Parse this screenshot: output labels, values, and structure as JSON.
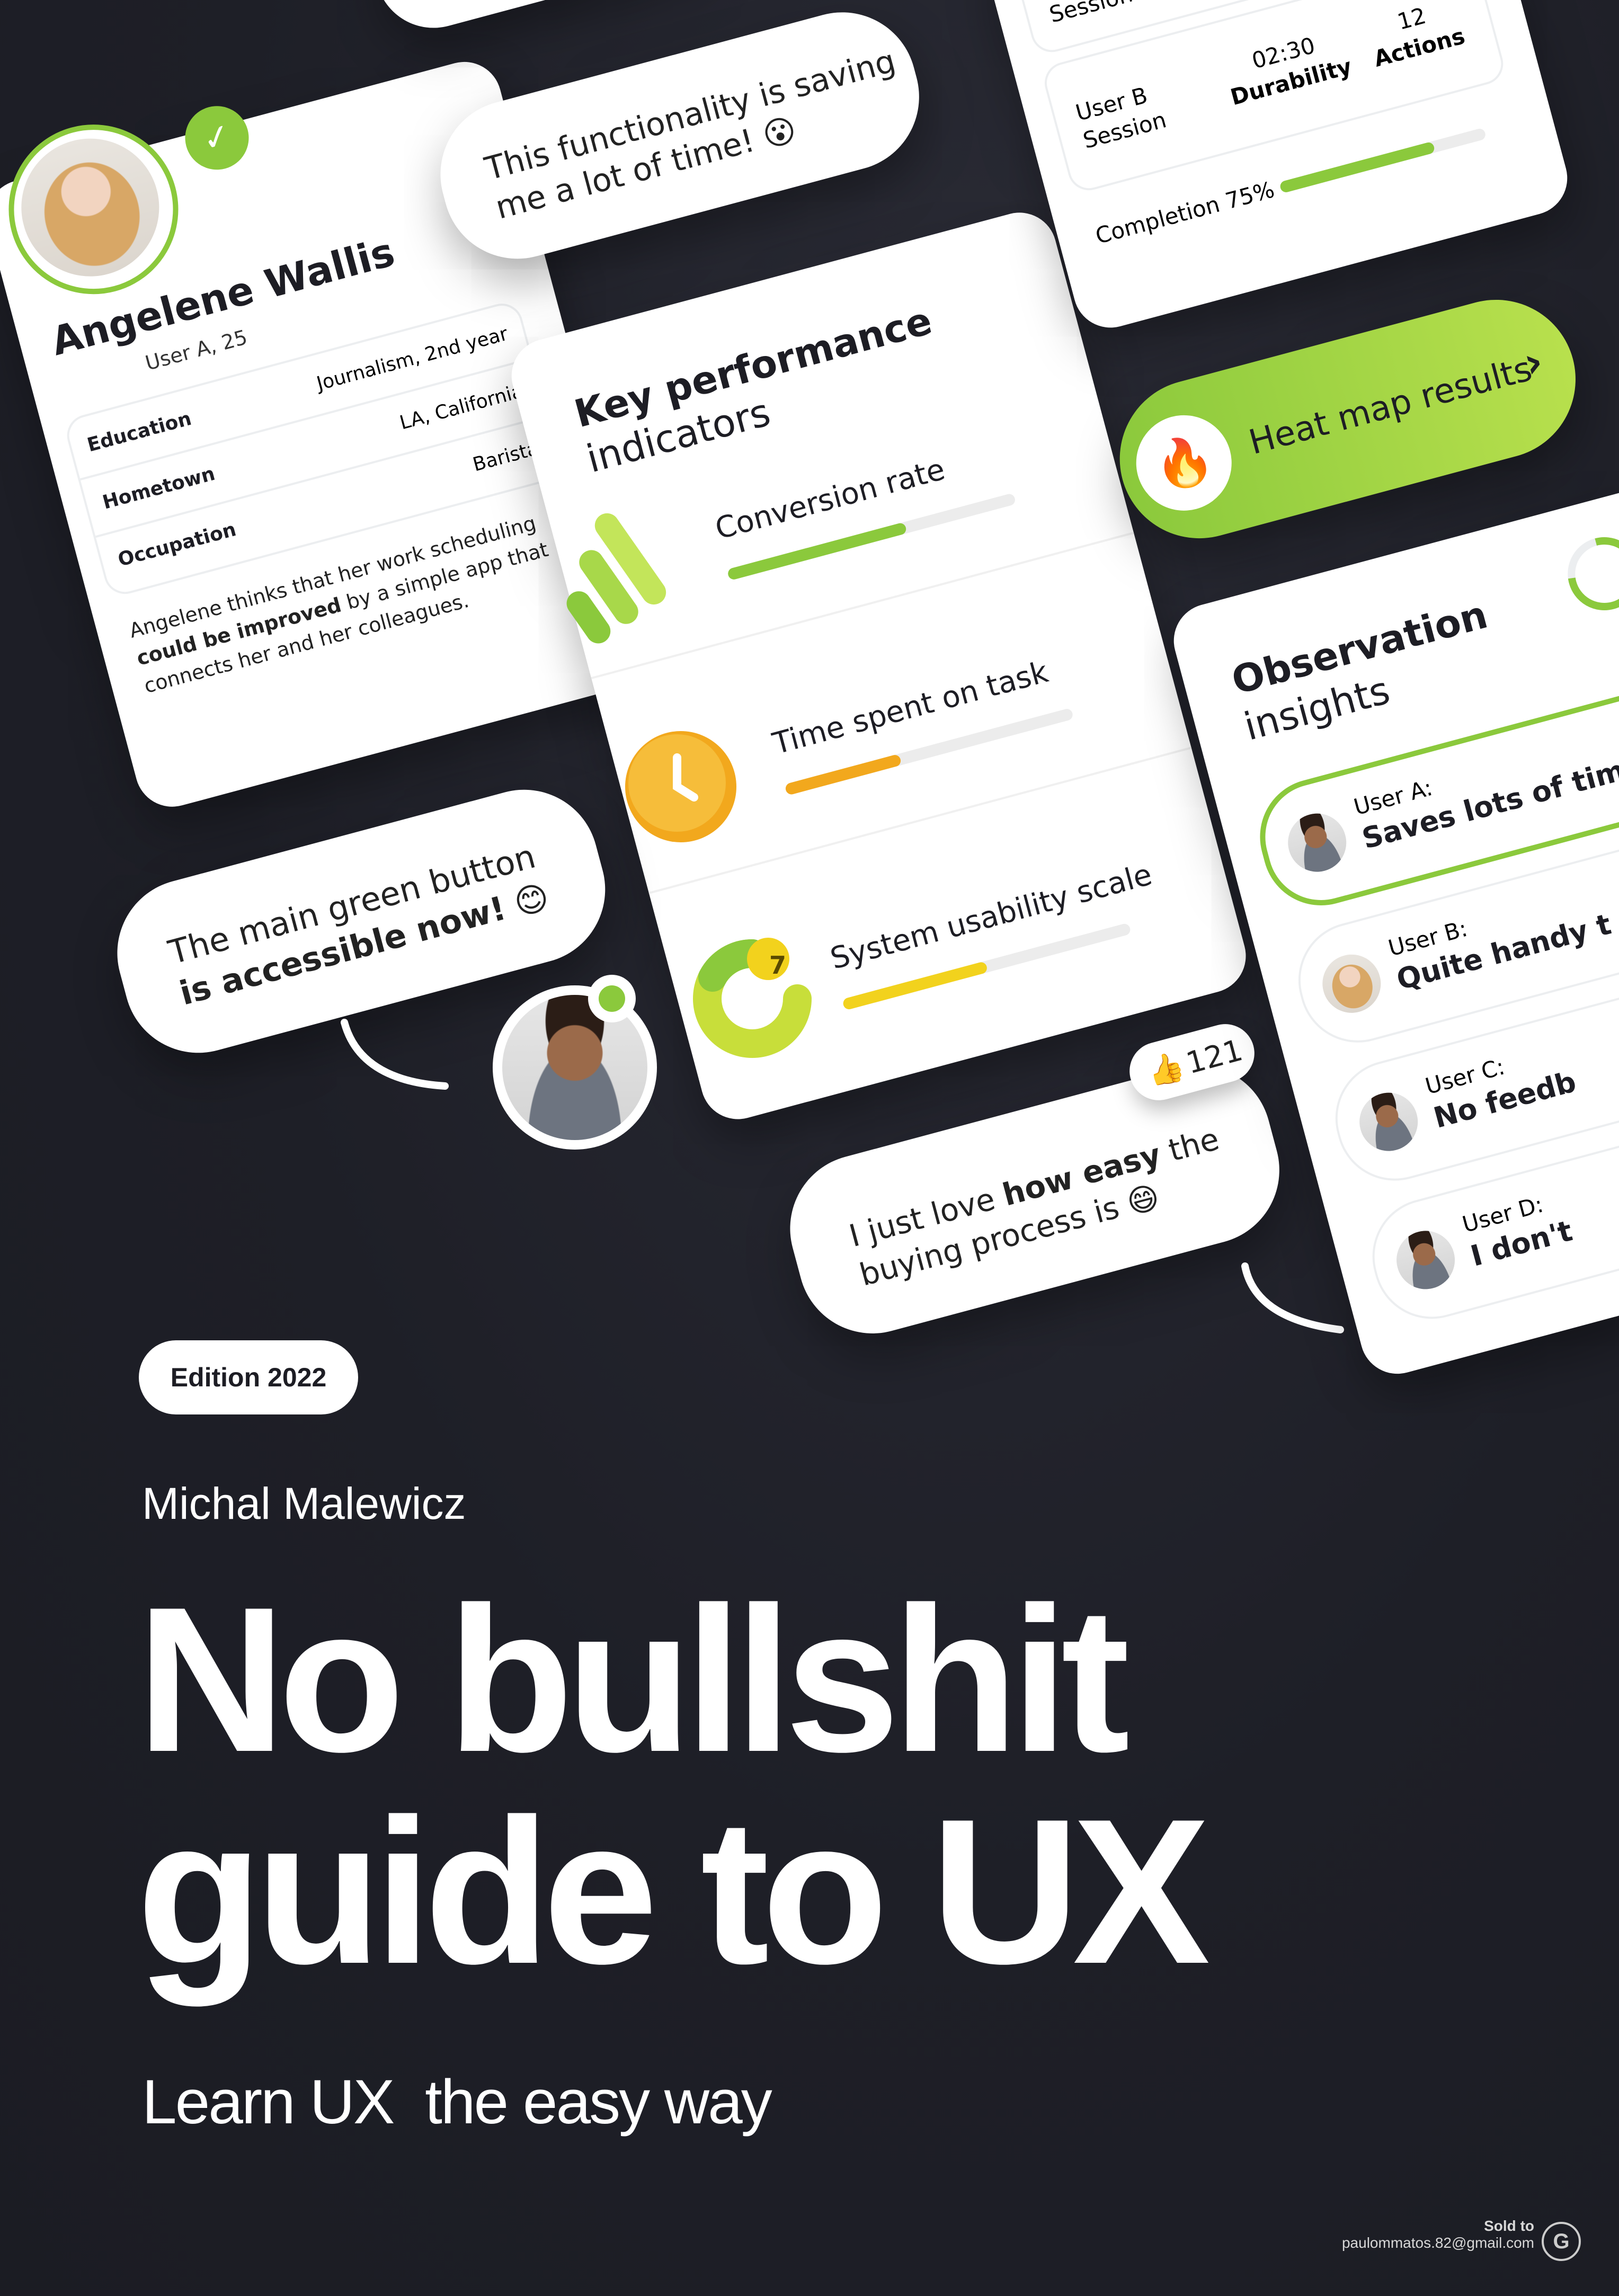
{
  "profile": {
    "name": "Angelene Wallis",
    "subtitle": "User A, 25",
    "rows": [
      {
        "key": "Education",
        "value": "Journalism, 2nd year"
      },
      {
        "key": "Hometown",
        "value": "LA, California"
      },
      {
        "key": "Occupation",
        "value": "Barista"
      }
    ],
    "desc_1": "Angelene thinks that her work scheduling",
    "desc_2_bold": "could be improved",
    "desc_2_rest": " by a simple app that",
    "desc_3": "connects her and her colleagues."
  },
  "quotes": {
    "q1_line1": "This functionality is saving",
    "q1_line2": "me a lot of time! 😮",
    "q2_line1": "The main green button",
    "q2_line2_bold": "is accessible now!",
    "q2_emoji": "😊",
    "q3_line1_a": "I just love ",
    "q3_line1_bold": "how easy",
    "q3_line1_b": " the",
    "q3_line2": "buying process is 😄",
    "likes_icon": "👍",
    "likes_count": "121"
  },
  "kpi": {
    "title_bold": "Key performance",
    "title_light": "indicators",
    "metrics": [
      {
        "label": "Conversion rate",
        "fraction": 0.62,
        "color": "#8bc93c"
      },
      {
        "label": "Time spent on task",
        "fraction": 0.4,
        "color": "#f2a81d"
      },
      {
        "label": "System usability scale",
        "fraction": 0.5,
        "color": "#f2d21d"
      }
    ],
    "badge_number": "7"
  },
  "session": {
    "top_label": "Session",
    "user_line1": "User B",
    "user_line2": "Session",
    "duration_value": "02:30",
    "duration_label": "Durability",
    "actions_value": "12",
    "actions_label": "Actions",
    "completion_label": "Completion 75%",
    "completion_fraction": 0.75
  },
  "heatmap": {
    "label": "Heat map results",
    "icon": "🔥",
    "arrow": "›"
  },
  "observation": {
    "title_bold": "Observation",
    "title_light": "insights",
    "users": [
      {
        "user": "User A:",
        "text": "Saves lots of time"
      },
      {
        "user": "User B:",
        "text": "Quite handy t"
      },
      {
        "user": "User C:",
        "text": "No feedb"
      },
      {
        "user": "User D:",
        "text": "I don't"
      }
    ]
  },
  "cover": {
    "edition": "Edition 2022",
    "author": "Michal Malewicz",
    "title_line1": "No bullshit",
    "title_line2": "guide to UX",
    "tagline": "Learn UX  the easy way"
  },
  "footer": {
    "sold_to": "Sold to",
    "email": "paulommatos.82@gmail.com",
    "logo_letter": "G"
  },
  "colors": {
    "accent_green": "#8bc93c",
    "background": "#1f2028",
    "orange": "#f2a81d",
    "yellow": "#f2d21d"
  }
}
